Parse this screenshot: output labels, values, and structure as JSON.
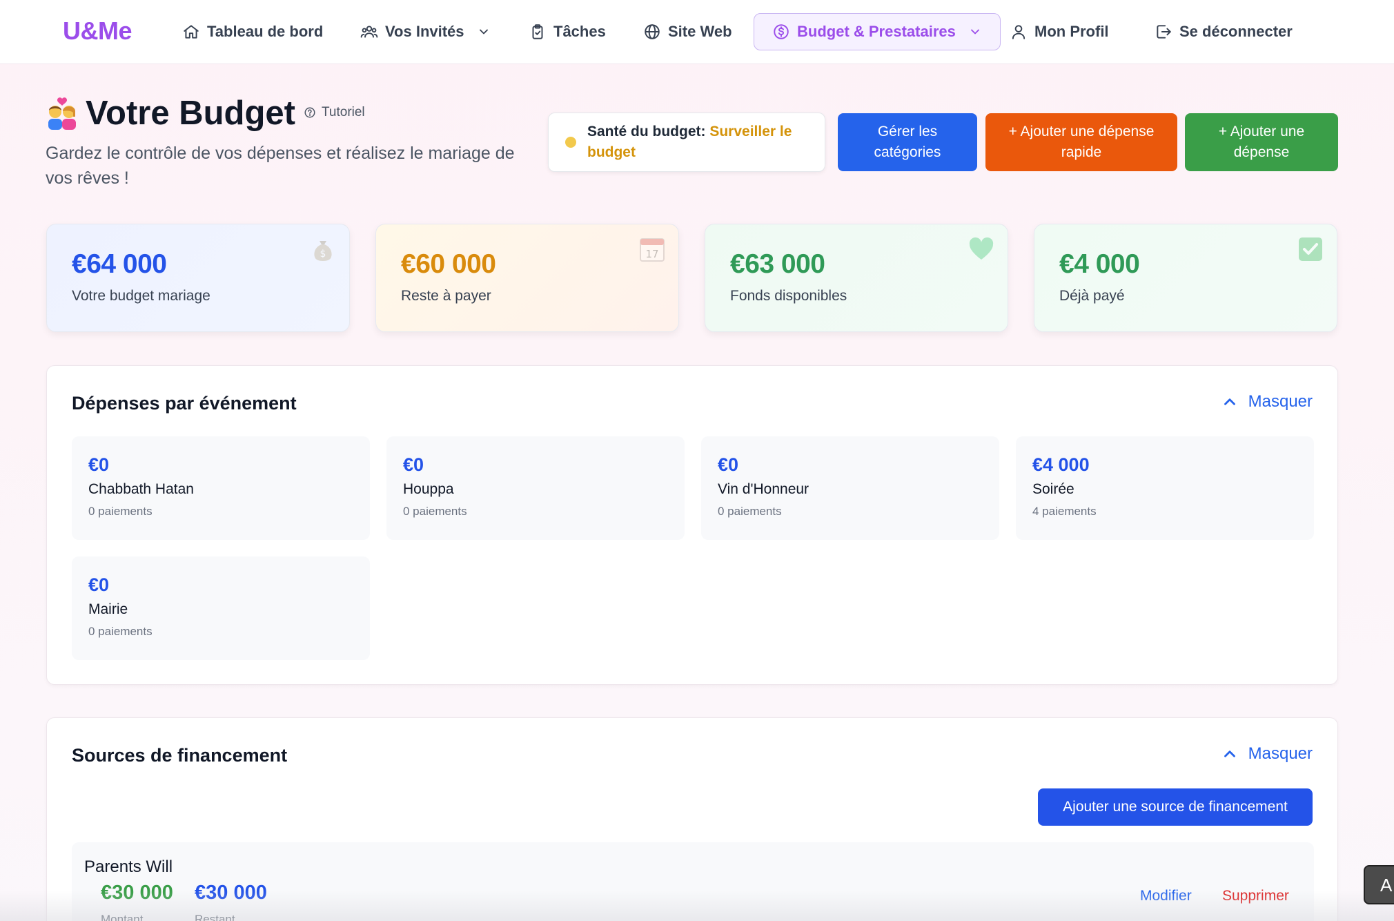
{
  "nav": {
    "logo": "U&Me",
    "items": [
      {
        "label": "Tableau de bord",
        "icon": "home-icon"
      },
      {
        "label": "Vos Invités",
        "icon": "users-icon",
        "dropdown": true
      },
      {
        "label": "Tâches",
        "icon": "clipboard-icon"
      },
      {
        "label": "Site Web",
        "icon": "globe-icon"
      },
      {
        "label": "Budget & Prestataires",
        "icon": "dollar-circle-icon",
        "dropdown": true,
        "active": true
      },
      {
        "label": "Mon Profil",
        "icon": "user-icon"
      },
      {
        "label": "Se déconnecter",
        "icon": "logout-icon"
      }
    ]
  },
  "header": {
    "title": "Votre Budget",
    "tutorial": "Tutoriel",
    "subtitle": "Gardez le contrôle de vos dépenses et réalisez le mariage de vos rêves !",
    "health_label": "Santé du budget:",
    "health_status": "Surveiller le budget",
    "btn_categories": "Gérer les catégories",
    "btn_quick_expense": "+ Ajouter une dépense rapide",
    "btn_expense": "+ Ajouter une dépense"
  },
  "stats": [
    {
      "value": "€64 000",
      "label": "Votre budget mariage",
      "icon": "money-bag-icon"
    },
    {
      "value": "€60 000",
      "label": "Reste à payer",
      "icon": "calendar-icon"
    },
    {
      "value": "€63 000",
      "label": "Fonds disponibles",
      "icon": "heart-icon"
    },
    {
      "value": "€4 000",
      "label": "Déjà payé",
      "icon": "check-box-icon"
    }
  ],
  "events": {
    "title": "Dépenses par événement",
    "toggle": "Masquer",
    "items": [
      {
        "amount": "€0",
        "name": "Chabbath Hatan",
        "count": "0 paiements"
      },
      {
        "amount": "€0",
        "name": "Houppa",
        "count": "0 paiements"
      },
      {
        "amount": "€0",
        "name": "Vin d'Honneur",
        "count": "0 paiements"
      },
      {
        "amount": "€4 000",
        "name": "Soirée",
        "count": "4 paiements"
      },
      {
        "amount": "€0",
        "name": "Mairie",
        "count": "0 paiements"
      }
    ]
  },
  "funding": {
    "title": "Sources de financement",
    "toggle": "Masquer",
    "add_button": "Ajouter une source de financement",
    "sources": [
      {
        "name": "Parents Will",
        "amount": "€30 000",
        "amount_label": "Montant",
        "remaining": "€30 000",
        "remaining_label": "Restant",
        "edit": "Modifier",
        "delete": "Supprimer"
      }
    ]
  },
  "floating_tab": "A",
  "colors": {
    "brand": "#9b4dea",
    "primary": "#2563eb",
    "orange": "#ea580c",
    "green": "#3a9e48",
    "warning": "#d4930a",
    "danger": "#dc2626"
  }
}
